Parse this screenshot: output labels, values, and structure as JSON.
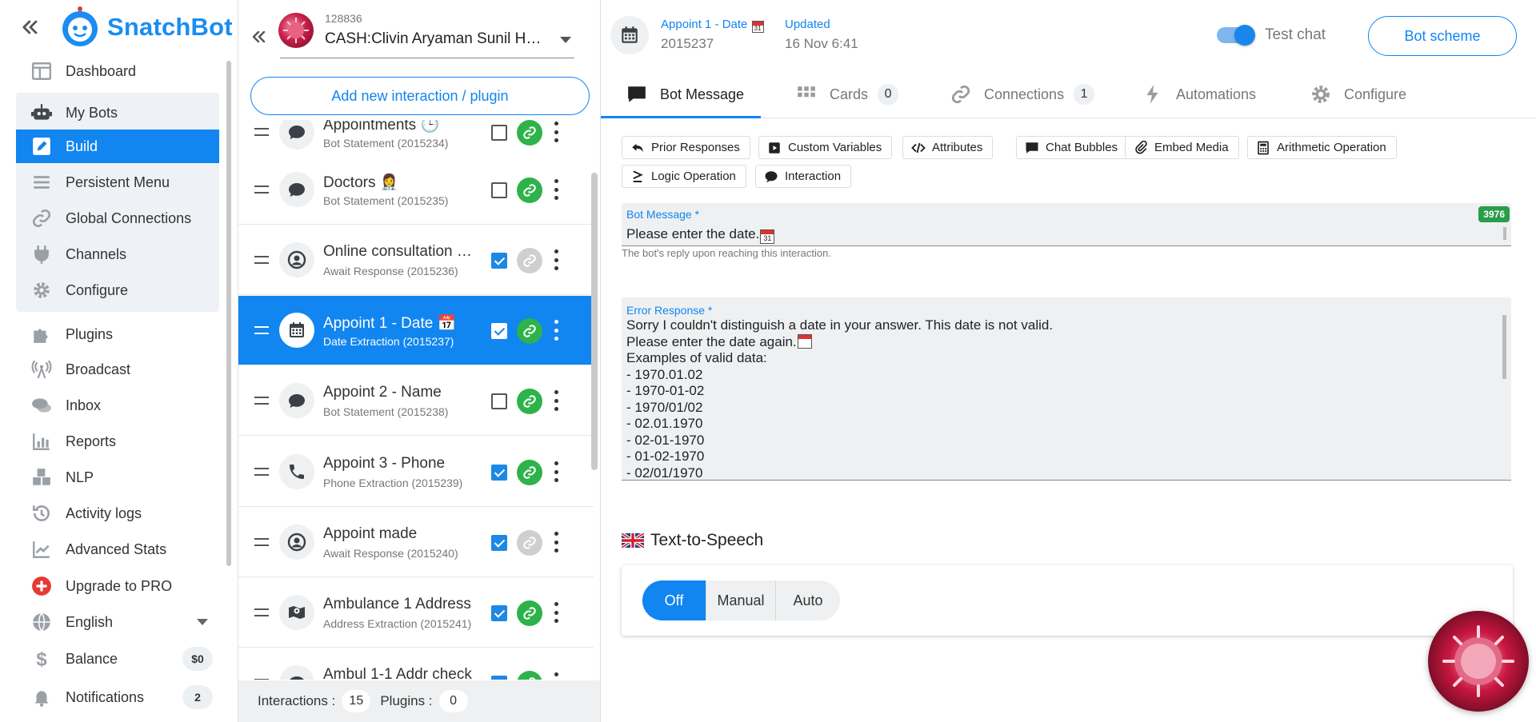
{
  "sidebar": {
    "brand": "SnatchBot",
    "nav": [
      {
        "label": "Dashboard",
        "icon": "dashboard-icon"
      },
      {
        "label": "My Bots",
        "icon": "robot-icon"
      },
      {
        "label": "Build",
        "icon": "pencil-icon"
      },
      {
        "label": "Persistent Menu",
        "icon": "menu-icon"
      },
      {
        "label": "Global Connections",
        "icon": "link-icon"
      },
      {
        "label": "Channels",
        "icon": "plug-icon"
      },
      {
        "label": "Configure",
        "icon": "gear-icon"
      },
      {
        "label": "Plugins",
        "icon": "puzzle-icon"
      },
      {
        "label": "Broadcast",
        "icon": "broadcast-icon"
      },
      {
        "label": "Inbox",
        "icon": "chat-icon"
      },
      {
        "label": "Reports",
        "icon": "bar-chart-icon"
      },
      {
        "label": "NLP",
        "icon": "cubes-icon"
      },
      {
        "label": "Activity logs",
        "icon": "history-icon"
      },
      {
        "label": "Advanced Stats",
        "icon": "line-chart-icon"
      },
      {
        "label": "Upgrade to PRO",
        "icon": "plus-badge-icon"
      },
      {
        "label": "English",
        "icon": "globe-icon"
      },
      {
        "label": "Balance",
        "icon": "dollar-icon",
        "badge": "$0"
      },
      {
        "label": "Notifications",
        "icon": "bell-icon",
        "badge": "2"
      }
    ]
  },
  "bot": {
    "id": "128836",
    "name": "CASH:Clivin Aryaman Sunil Harsh Bot"
  },
  "middle": {
    "add_button": "Add new interaction / plugin",
    "footer": {
      "interactions_label": "Interactions :",
      "interactions_count": "15",
      "plugins_label": "Plugins :",
      "plugins_count": "0"
    }
  },
  "interactions": [
    {
      "title": "Appointments 🕒",
      "sub": "Bot Statement (2015234)",
      "icon": "speech-bubble-icon",
      "checked": false,
      "linked": true
    },
    {
      "title": "Doctors 👩‍⚕️",
      "sub": "Bot Statement (2015235)",
      "icon": "speech-bubble-icon",
      "checked": false,
      "linked": true
    },
    {
      "title": "Online consultation with doctor",
      "sub": "Await Response (2015236)",
      "icon": "user-circle-icon",
      "checked": true,
      "linked": false
    },
    {
      "title": "Appoint 1 - Date 📅",
      "sub": "Date Extraction (2015237)",
      "icon": "calendar-icon",
      "checked": true,
      "linked": true
    },
    {
      "title": "Appoint 2 - Name",
      "sub": "Bot Statement (2015238)",
      "icon": "speech-bubble-icon",
      "checked": false,
      "linked": true
    },
    {
      "title": "Appoint 3 - Phone",
      "sub": "Phone Extraction (2015239)",
      "icon": "phone-icon",
      "checked": true,
      "linked": true
    },
    {
      "title": "Appoint made",
      "sub": "Await Response (2015240)",
      "icon": "user-circle-icon",
      "checked": true,
      "linked": false
    },
    {
      "title": "Ambulance 1 Address",
      "sub": "Address Extraction (2015241)",
      "icon": "map-pin-icon",
      "checked": true,
      "linked": true
    },
    {
      "title": "Ambul 1-1 Addr check",
      "sub": "",
      "icon": "speech-bubble-icon",
      "checked": true,
      "linked": true
    }
  ],
  "editor": {
    "name": "Appoint 1 - Date",
    "id": "2015237",
    "updated_label": "Updated",
    "updated_value": "16 Nov 6:41",
    "test_chat": "Test chat",
    "bot_scheme": "Bot scheme",
    "tabs": [
      {
        "label": "Bot Message",
        "icon": "speech-bubble-icon"
      },
      {
        "label": "Cards",
        "icon": "grid-icon",
        "count": "0"
      },
      {
        "label": "Connections",
        "icon": "link-icon",
        "count": "1"
      },
      {
        "label": "Automations",
        "icon": "lightning-icon"
      },
      {
        "label": "Configure",
        "icon": "gear-icon"
      }
    ],
    "chips": [
      {
        "label": "Prior Responses",
        "icon": "reply-icon"
      },
      {
        "label": "Custom Variables",
        "icon": "play-square-icon"
      },
      {
        "label": "Attributes",
        "icon": "code-icon"
      },
      {
        "label": "Chat Bubbles",
        "icon": "chat-bubble-icon"
      },
      {
        "label": "Embed Media",
        "icon": "paperclip-icon"
      },
      {
        "label": "Arithmetic Operation",
        "icon": "calculator-icon"
      },
      {
        "label": "Logic Operation",
        "icon": "greater-equal-icon"
      },
      {
        "label": "Interaction",
        "icon": "comment-icon"
      }
    ],
    "bot_message_label": "Bot Message *",
    "bot_message": "Please enter the date.",
    "char_count": "3976",
    "bot_message_help": "The bot's reply upon reaching this interaction.",
    "error_label": "Error Response *",
    "error_lines": [
      "Sorry I couldn't distinguish a date in your answer. This date is not valid.",
      "Please enter the date again.",
      "Examples of valid data:",
      "- 1970.01.02",
      "- 1970-01-02",
      "- 1970/01/02",
      "- 02.01.1970",
      "- 02-01-1970",
      "- 01-02-1970",
      "- 02/01/1970"
    ],
    "tts_title": "Text-to-Speech",
    "tts_options": [
      "Off",
      "Manual",
      "Auto"
    ],
    "tts_selected": "Off"
  },
  "colors": {
    "accent": "#1185f0",
    "link_green": "#2db34a",
    "counter_green": "#2a9d4a"
  }
}
